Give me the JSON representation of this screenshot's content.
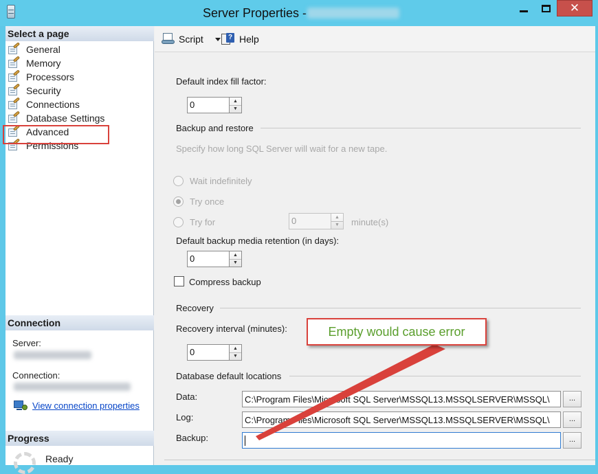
{
  "window": {
    "title": "Server Properties -",
    "minimize": "minimize",
    "maximize": "maximize",
    "close": "✕"
  },
  "sidebar": {
    "select_page_header": "Select a page",
    "pages": [
      {
        "label": "General"
      },
      {
        "label": "Memory"
      },
      {
        "label": "Processors"
      },
      {
        "label": "Security"
      },
      {
        "label": "Connections"
      },
      {
        "label": "Database Settings",
        "selected": true
      },
      {
        "label": "Advanced"
      },
      {
        "label": "Permissions"
      }
    ],
    "connection_header": "Connection",
    "server_label": "Server:",
    "connection_label": "Connection:",
    "view_connection_link": "View connection properties",
    "progress_header": "Progress",
    "progress_status": "Ready"
  },
  "toolbar": {
    "script_label": "Script",
    "help_label": "Help"
  },
  "settings": {
    "fill_factor_label": "Default index fill factor:",
    "fill_factor_value": "0",
    "backup_restore_title": "Backup and restore",
    "tape_wait_hint": "Specify how long SQL Server will wait for a new tape.",
    "radio_wait_indefinitely": "Wait indefinitely",
    "radio_try_once": "Try once",
    "radio_try_for": "Try for",
    "try_for_value": "0",
    "try_for_unit": "minute(s)",
    "retention_label": "Default backup media retention (in days):",
    "retention_value": "0",
    "compress_backup_label": "Compress backup",
    "compress_backup_checked": false,
    "recovery_title": "Recovery",
    "recovery_interval_label": "Recovery interval (minutes):",
    "recovery_interval_value": "0",
    "default_locations_title": "Database default locations",
    "data_label": "Data:",
    "data_path": "C:\\Program Files\\Microsoft SQL Server\\MSSQL13.MSSQLSERVER\\MSSQL\\",
    "log_label": "Log:",
    "log_path": "C:\\Program Files\\Microsoft SQL Server\\MSSQL13.MSSQLSERVER\\MSSQL\\",
    "backup_label": "Backup:",
    "backup_path": "",
    "browse_label": "..."
  },
  "annotation": {
    "callout_text": "Empty would cause error",
    "color": "#d9413b",
    "text_color": "#5a9e2c"
  },
  "colors": {
    "titlebar": "#5fcbea",
    "close_button": "#c7504b",
    "link": "#0645c8",
    "highlight": "#d9413b"
  }
}
